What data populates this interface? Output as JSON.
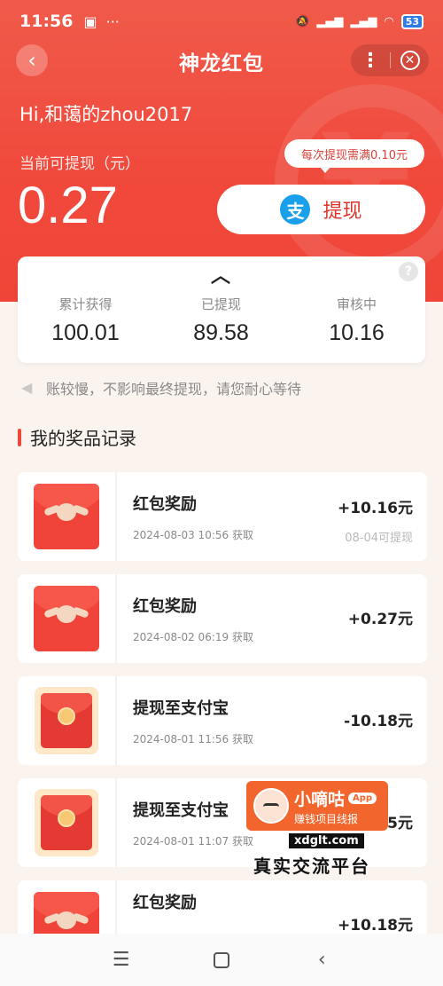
{
  "status_bar": {
    "time": "11:56",
    "battery": "53"
  },
  "nav": {
    "title": "神龙红包",
    "back_icon": "chevron-left-icon",
    "more_icon": "more-dots-icon",
    "close_icon": "close-circle-icon"
  },
  "header": {
    "greeting": "Hi,和蔼的zhou2017",
    "balance_label": "当前可提现（元）",
    "balance_amount": "0.27",
    "tip": "每次提现需满0.10元",
    "withdraw_label": "提现",
    "withdraw_icon": "alipay-icon"
  },
  "stats": [
    {
      "label": "累计获得",
      "value": "100.01"
    },
    {
      "label": "已提现",
      "value": "89.58"
    },
    {
      "label": "审核中",
      "value": "10.16"
    }
  ],
  "notice": "账较慢，不影响最终提现，请您耐心等待",
  "section_title": "我的奖品记录",
  "records": [
    {
      "title": "红包奖励",
      "date": "2024-08-03 10:56 获取",
      "amount": "+10.16元",
      "sub": "08-04可提现",
      "thumb": "red-packet"
    },
    {
      "title": "红包奖励",
      "date": "2024-08-02 06:19 获取",
      "amount": "+0.27元",
      "sub": "",
      "thumb": "red-packet"
    },
    {
      "title": "提现至支付宝",
      "date": "2024-08-01 11:56 获取",
      "amount": "-10.18元",
      "sub": "",
      "thumb": "envelope"
    },
    {
      "title": "提现至支付宝",
      "date": "2024-08-01 11:07 获取",
      "amount": "5元",
      "sub": "",
      "thumb": "envelope"
    },
    {
      "title": "红包奖励",
      "date": "",
      "amount": "+10.18元",
      "sub": "",
      "thumb": "red-packet"
    }
  ],
  "watermark": {
    "title": "小嘀咕",
    "app": "App",
    "subtitle": "赚钱项目线报",
    "url": "xdglt.com",
    "slogan": "真实交流平台"
  },
  "colors": {
    "primary_red": "#f04a3d",
    "alipay_blue": "#1aa0ea"
  }
}
